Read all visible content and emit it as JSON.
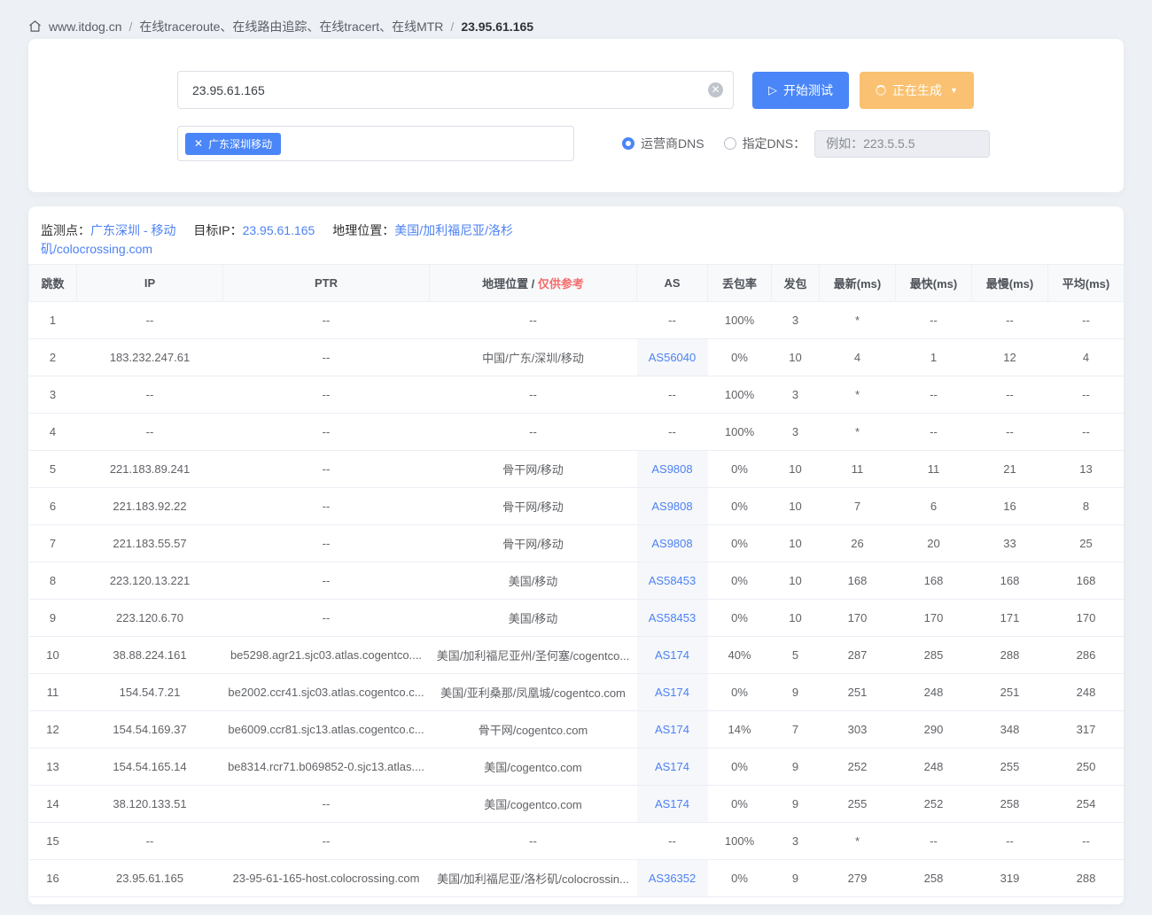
{
  "colors": {
    "accent_blue": "#4a86f7",
    "warning_orange": "#f9c171",
    "link_blue": "#4d82f3",
    "danger_red": "#f56c6c",
    "page_background": "#edf0f5"
  },
  "breadcrumb": {
    "site": "www.itdog.cn",
    "separator": "/",
    "section": "在线traceroute、在线路由追踪、在线tracert、在线MTR",
    "current": "23.95.61.165"
  },
  "controls": {
    "target_input": "23.95.61.165",
    "start_button": "开始测试",
    "play_icon": "▷",
    "generating_button": "正在生成",
    "caret_icon": "▼",
    "tag_close_icon": "✕",
    "node_tag": "广东深圳移动",
    "dns_radio_isp": "运营商DNS",
    "dns_radio_custom": "指定DNS：",
    "dns_placeholder": "例如：223.5.5.5"
  },
  "result_header": {
    "monitor_label": "监测点：",
    "monitor_value": "广东深圳 - 移动",
    "target_label": "目标IP：",
    "target_value": "23.95.61.165",
    "geo_label": "地理位置：",
    "geo_value": "美国/加利福尼亚/洛杉矶/colocrossing.com"
  },
  "table": {
    "headers": {
      "hop": "跳数",
      "ip": "IP",
      "ptr": "PTR",
      "geo": "地理位置 /",
      "geo_note": "仅供参考",
      "as": "AS",
      "loss": "丢包率",
      "sent": "发包",
      "latest": "最新(ms)",
      "fastest": "最快(ms)",
      "slowest": "最慢(ms)",
      "avg": "平均(ms)"
    },
    "rows": [
      {
        "hop": "1",
        "ip": "--",
        "ptr": "--",
        "geo": "--",
        "as": "--",
        "loss": "100%",
        "sent": "3",
        "latest": "*",
        "fastest": "--",
        "slowest": "--",
        "avg": "--"
      },
      {
        "hop": "2",
        "ip": "183.232.247.61",
        "ptr": "--",
        "geo": "中国/广东/深圳/移动",
        "as": "AS56040",
        "loss": "0%",
        "sent": "10",
        "latest": "4",
        "fastest": "1",
        "slowest": "12",
        "avg": "4"
      },
      {
        "hop": "3",
        "ip": "--",
        "ptr": "--",
        "geo": "--",
        "as": "--",
        "loss": "100%",
        "sent": "3",
        "latest": "*",
        "fastest": "--",
        "slowest": "--",
        "avg": "--"
      },
      {
        "hop": "4",
        "ip": "--",
        "ptr": "--",
        "geo": "--",
        "as": "--",
        "loss": "100%",
        "sent": "3",
        "latest": "*",
        "fastest": "--",
        "slowest": "--",
        "avg": "--"
      },
      {
        "hop": "5",
        "ip": "221.183.89.241",
        "ptr": "--",
        "geo": "骨干网/移动",
        "as": "AS9808",
        "loss": "0%",
        "sent": "10",
        "latest": "11",
        "fastest": "11",
        "slowest": "21",
        "avg": "13"
      },
      {
        "hop": "6",
        "ip": "221.183.92.22",
        "ptr": "--",
        "geo": "骨干网/移动",
        "as": "AS9808",
        "loss": "0%",
        "sent": "10",
        "latest": "7",
        "fastest": "6",
        "slowest": "16",
        "avg": "8"
      },
      {
        "hop": "7",
        "ip": "221.183.55.57",
        "ptr": "--",
        "geo": "骨干网/移动",
        "as": "AS9808",
        "loss": "0%",
        "sent": "10",
        "latest": "26",
        "fastest": "20",
        "slowest": "33",
        "avg": "25"
      },
      {
        "hop": "8",
        "ip": "223.120.13.221",
        "ptr": "--",
        "geo": "美国/移动",
        "as": "AS58453",
        "loss": "0%",
        "sent": "10",
        "latest": "168",
        "fastest": "168",
        "slowest": "168",
        "avg": "168"
      },
      {
        "hop": "9",
        "ip": "223.120.6.70",
        "ptr": "--",
        "geo": "美国/移动",
        "as": "AS58453",
        "loss": "0%",
        "sent": "10",
        "latest": "170",
        "fastest": "170",
        "slowest": "171",
        "avg": "170"
      },
      {
        "hop": "10",
        "ip": "38.88.224.161",
        "ptr": "be5298.agr21.sjc03.atlas.cogentco....",
        "geo": "美国/加利福尼亚州/圣何塞/cogentco...",
        "as": "AS174",
        "loss": "40%",
        "sent": "5",
        "latest": "287",
        "fastest": "285",
        "slowest": "288",
        "avg": "286"
      },
      {
        "hop": "11",
        "ip": "154.54.7.21",
        "ptr": "be2002.ccr41.sjc03.atlas.cogentco.c...",
        "geo": "美国/亚利桑那/凤凰城/cogentco.com",
        "as": "AS174",
        "loss": "0%",
        "sent": "9",
        "latest": "251",
        "fastest": "248",
        "slowest": "251",
        "avg": "248"
      },
      {
        "hop": "12",
        "ip": "154.54.169.37",
        "ptr": "be6009.ccr81.sjc13.atlas.cogentco.c...",
        "geo": "骨干网/cogentco.com",
        "as": "AS174",
        "loss": "14%",
        "sent": "7",
        "latest": "303",
        "fastest": "290",
        "slowest": "348",
        "avg": "317"
      },
      {
        "hop": "13",
        "ip": "154.54.165.14",
        "ptr": "be8314.rcr71.b069852-0.sjc13.atlas....",
        "geo": "美国/cogentco.com",
        "as": "AS174",
        "loss": "0%",
        "sent": "9",
        "latest": "252",
        "fastest": "248",
        "slowest": "255",
        "avg": "250"
      },
      {
        "hop": "14",
        "ip": "38.120.133.51",
        "ptr": "--",
        "geo": "美国/cogentco.com",
        "as": "AS174",
        "loss": "0%",
        "sent": "9",
        "latest": "255",
        "fastest": "252",
        "slowest": "258",
        "avg": "254"
      },
      {
        "hop": "15",
        "ip": "--",
        "ptr": "--",
        "geo": "--",
        "as": "--",
        "loss": "100%",
        "sent": "3",
        "latest": "*",
        "fastest": "--",
        "slowest": "--",
        "avg": "--"
      },
      {
        "hop": "16",
        "ip": "23.95.61.165",
        "ptr": "23-95-61-165-host.colocrossing.com",
        "geo": "美国/加利福尼亚/洛杉矶/colocrossin...",
        "as": "AS36352",
        "loss": "0%",
        "sent": "9",
        "latest": "279",
        "fastest": "258",
        "slowest": "319",
        "avg": "288"
      }
    ]
  }
}
